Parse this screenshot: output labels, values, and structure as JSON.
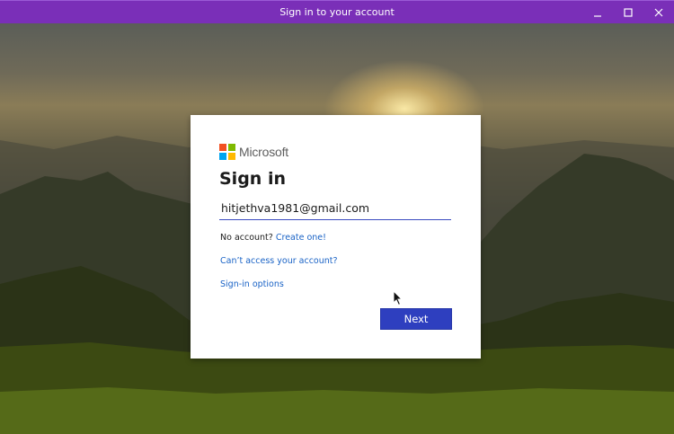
{
  "window": {
    "title": "Sign in to your account",
    "controls": [
      "minimize-icon",
      "maximize-icon",
      "close-icon"
    ]
  },
  "dialog": {
    "brand": "Microsoft",
    "logo_colors": [
      "#f25022",
      "#7fba00",
      "#00a4ef",
      "#ffb900"
    ],
    "heading": "Sign in",
    "email_value": "hitjethva1981@gmail.com",
    "no_account_text": "No account?",
    "create_link": "Create one!",
    "access_link": "Can’t access your account?",
    "options_link": "Sign-in options",
    "next_label": "Next"
  },
  "colors": {
    "titlebar": "#7a2fb8",
    "accent": "#2e3fbf",
    "link": "#1a63c6"
  }
}
